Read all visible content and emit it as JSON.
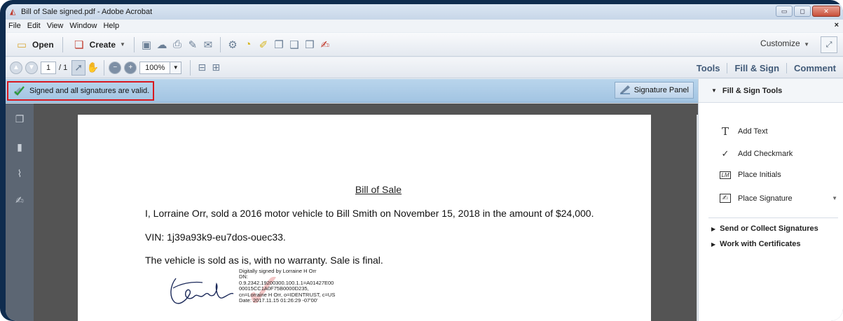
{
  "window": {
    "title": "Bill of Sale signed.pdf - Adobe Acrobat",
    "controls": {
      "minimize": "▭",
      "maximize": "◻",
      "close": "✕"
    }
  },
  "menu": {
    "items": [
      "File",
      "Edit",
      "View",
      "Window",
      "Help"
    ],
    "close": "×"
  },
  "toolbar": {
    "open_label": "Open",
    "create_label": "Create",
    "customize_label": "Customize",
    "icons": [
      "save-icon",
      "cloud-upload-icon",
      "print-icon",
      "edit-icon",
      "email-icon",
      "settings-icon",
      "comment-icon",
      "highlight-icon",
      "stamp-icon",
      "attach-icon",
      "share-icon",
      "sign-icon"
    ]
  },
  "navbar": {
    "page_current": "1",
    "page_total": "/ 1",
    "zoom": "100%"
  },
  "tabs": {
    "tools": "Tools",
    "fill_sign": "Fill & Sign",
    "comment": "Comment"
  },
  "signature_bar": {
    "status": "Signed and all signatures are valid.",
    "panel_button": "Signature Panel"
  },
  "document": {
    "title": "Bill of Sale",
    "line1": "I, Lorraine Orr, sold a 2016 motor vehicle to Bill Smith on November 15, 2018 in the amount of $24,000.",
    "line2": "VIN: 1j39a93k9-eu7dos-ouec33.",
    "line3": "The vehicle is sold as is, with no warranty.  Sale is final.",
    "signature": {
      "details": [
        "Digitally signed by Lorraine H Orr",
        "DN:",
        "0.9.2342.19200300.100.1.1=A01427E00",
        "00015CC1A0F75B0000D235,",
        "cn=Lorraine H Orr, o=IDENTRUST, c=US",
        "Date: 2017.11.15 01:26:29 -07'00'"
      ]
    }
  },
  "right_panel": {
    "header": "Fill & Sign Tools",
    "items": [
      {
        "label": "Add Text",
        "icon": "T"
      },
      {
        "label": "Add Checkmark",
        "icon": "✓"
      },
      {
        "label": "Place Initials",
        "icon": "LM"
      },
      {
        "label": "Place Signature",
        "icon": "✍"
      }
    ],
    "sections": [
      "Send or Collect Signatures",
      "Work with Certificates"
    ]
  }
}
